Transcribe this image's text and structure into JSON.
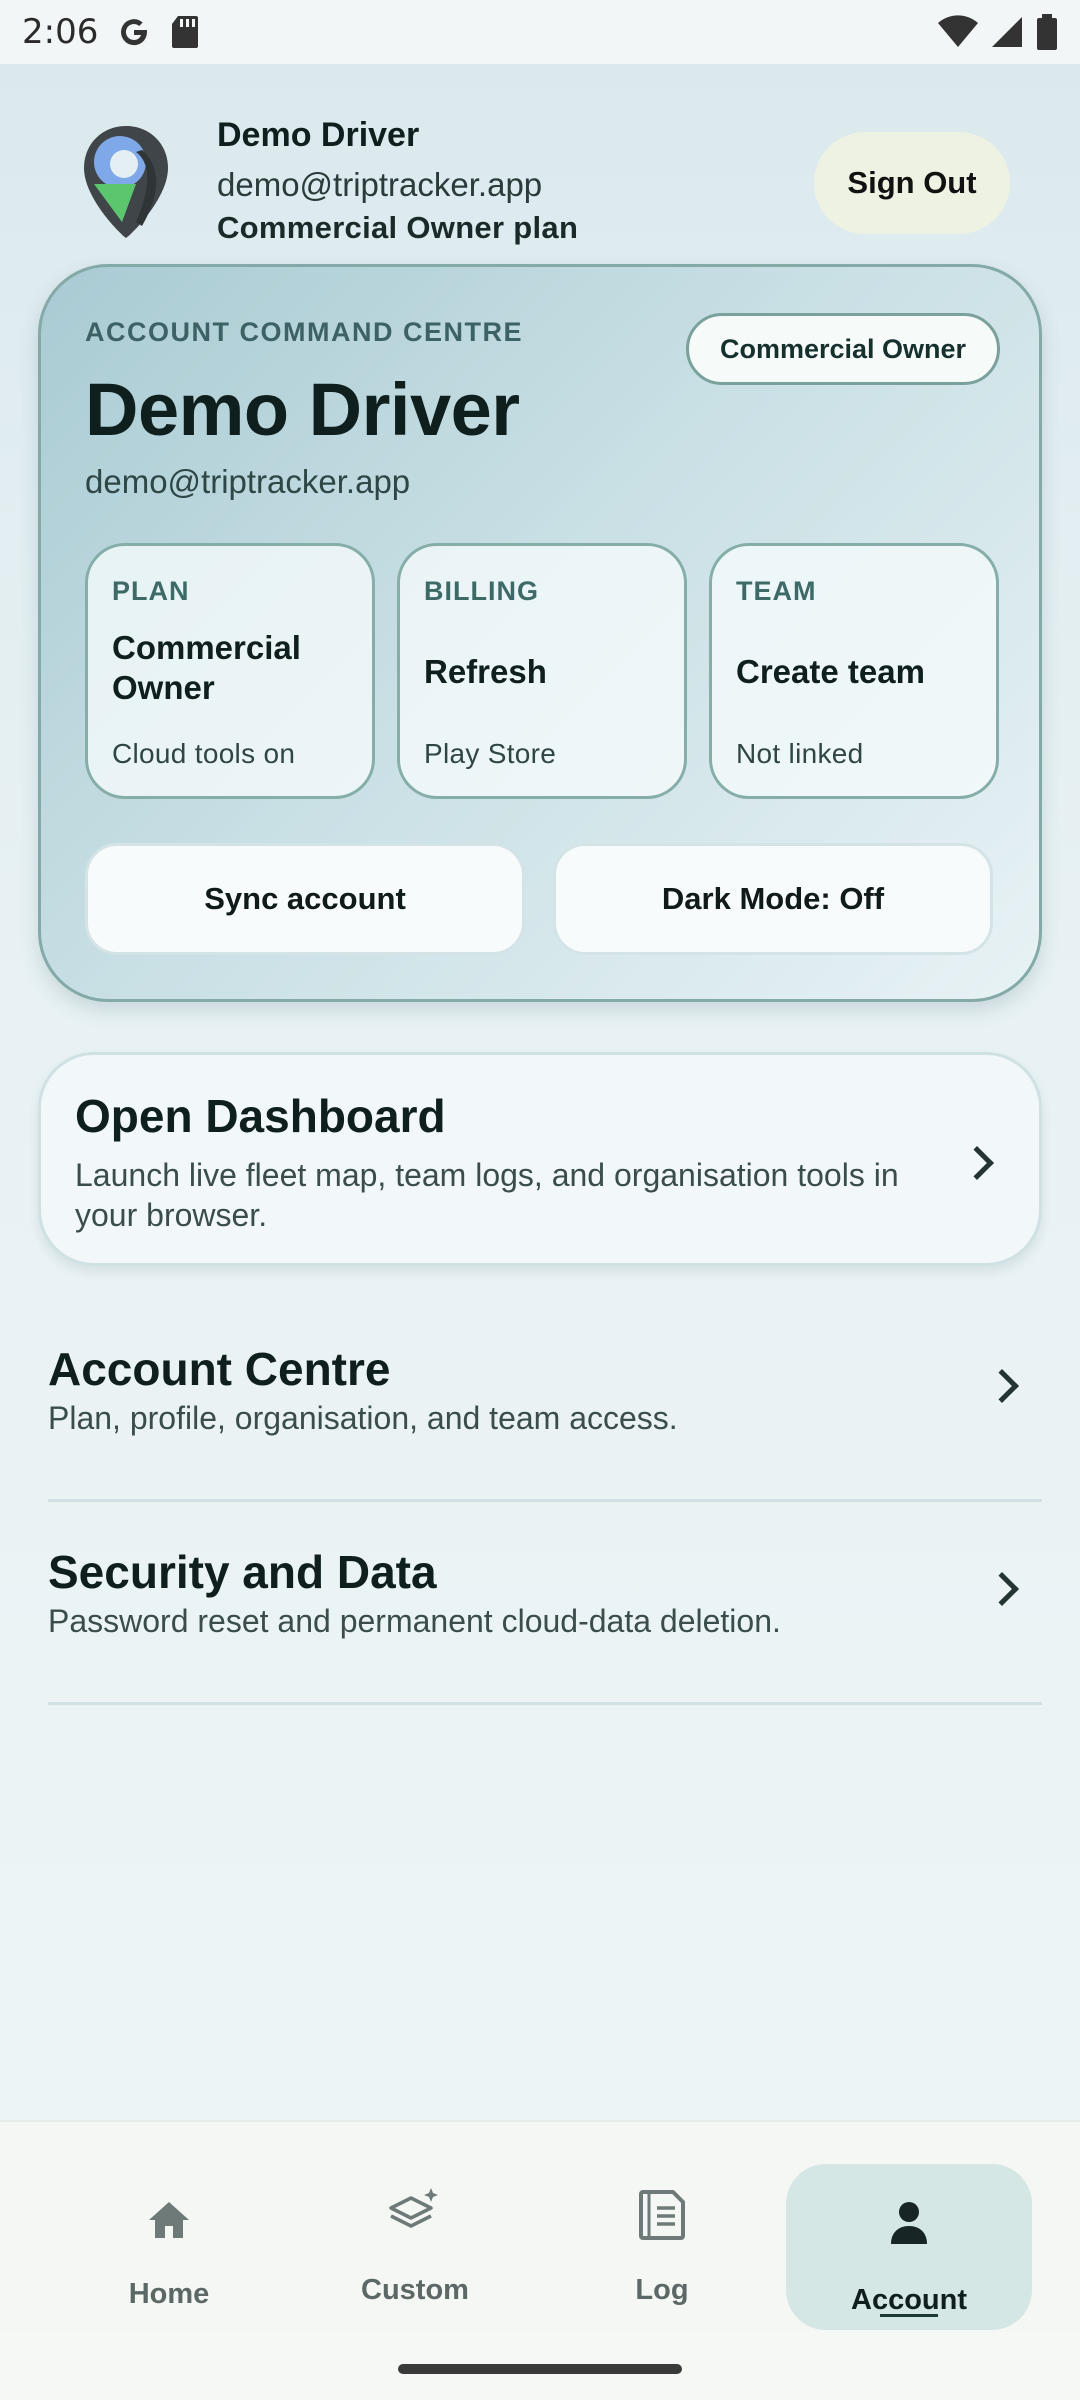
{
  "status_bar": {
    "time": "2:06"
  },
  "header": {
    "user_name": "Demo Driver",
    "email": "demo@triptracker.app",
    "plan": "Commercial Owner plan",
    "signout_label": "Sign Out"
  },
  "command_centre": {
    "label": "ACCOUNT COMMAND CENTRE",
    "badge": "Commercial Owner",
    "name": "Demo Driver",
    "email": "demo@triptracker.app",
    "tiles": [
      {
        "head": "PLAN",
        "value": "Commercial Owner",
        "sub": "Cloud tools on"
      },
      {
        "head": "BILLING",
        "value": "Refresh",
        "sub": "Play Store"
      },
      {
        "head": "TEAM",
        "value": "Create team",
        "sub": "Not linked"
      }
    ],
    "sync_label": "Sync account",
    "dark_mode_label": "Dark Mode: Off"
  },
  "dashboard": {
    "title": "Open Dashboard",
    "description": "Launch live fleet map, team logs, and organisation tools in your browser."
  },
  "list": [
    {
      "title": "Account Centre",
      "description": "Plan, profile, organisation, and team access."
    },
    {
      "title": "Security and Data",
      "description": "Password reset and permanent cloud-data deletion."
    }
  ],
  "nav": [
    {
      "label": "Home",
      "icon": "home-icon"
    },
    {
      "label": "Custom",
      "icon": "layers-sparkle-icon"
    },
    {
      "label": "Log",
      "icon": "document-icon"
    },
    {
      "label": "Account",
      "icon": "person-icon",
      "active": true
    }
  ],
  "colors": {
    "accent": "#84aaa7",
    "background": "#e3eff2",
    "active_nav": "#d5e7e4"
  }
}
